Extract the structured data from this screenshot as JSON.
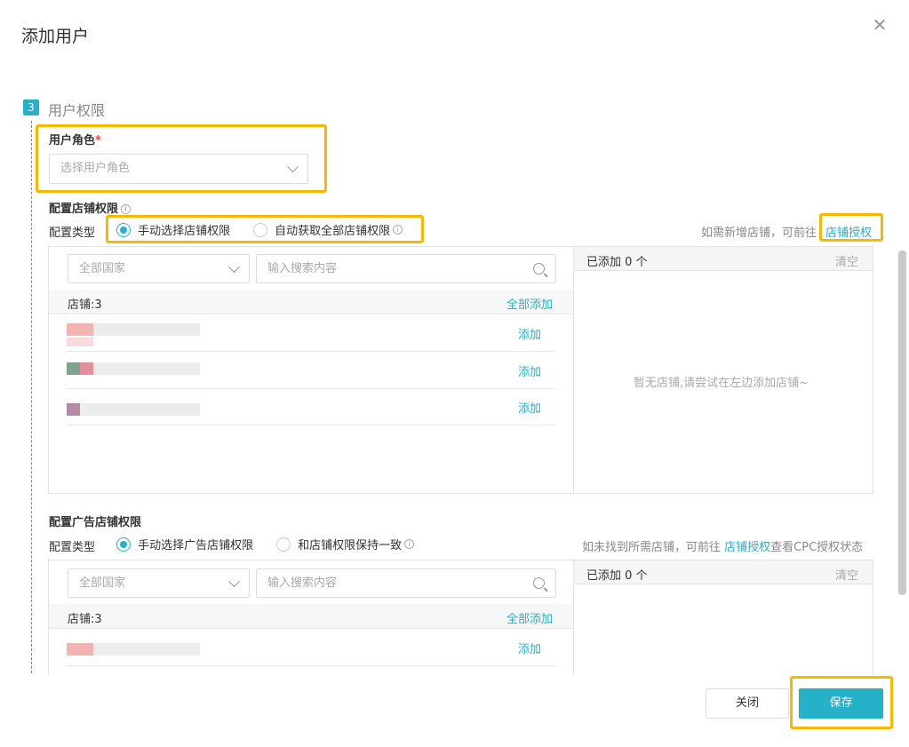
{
  "dialog": {
    "title": "添加用户",
    "close_icon": "close-icon"
  },
  "step": {
    "number": "3",
    "title": "用户权限"
  },
  "role": {
    "label": "用户角色",
    "required_mark": "*",
    "placeholder": "选择用户角色"
  },
  "store_perm": {
    "label": "配置店铺权限",
    "type_label": "配置类型",
    "option_manual": "手动选择店铺权限",
    "option_auto": "自动获取全部店铺权限",
    "hint_prefix": "如需新增店铺，可前往",
    "hint_link": "店铺授权",
    "country_placeholder": "全部国家",
    "search_placeholder": "输入搜索内容",
    "store_count": "店铺:3",
    "add_all": "全部添加",
    "rows": [
      {
        "add": "添加",
        "colors": [
          "#f2b3b3",
          "#e9e9e9"
        ]
      },
      {
        "add": "添加",
        "colors": [
          "#7fa38c",
          "#e58f9c"
        ]
      },
      {
        "add": "添加",
        "colors": [
          "#b98aa3",
          "#e9e9e9"
        ]
      }
    ],
    "added_label": "已添加 0 个",
    "clear": "清空",
    "empty_text": "暂无店铺,请尝试在左边添加店铺~"
  },
  "ad_perm": {
    "label": "配置广告店铺权限",
    "type_label": "配置类型",
    "option_manual": "手动选择广告店铺权限",
    "option_same": "和店铺权限保持一致",
    "hint_prefix": "如未找到所需店铺，可前往 ",
    "hint_link": "店铺授权",
    "hint_suffix": "查看CPC授权状态",
    "country_placeholder": "全部国家",
    "search_placeholder": "输入搜索内容",
    "store_count": "店铺:3",
    "add_all": "全部添加",
    "rows": [
      {
        "add": "添加",
        "colors": [
          "#f2b3b3",
          "#e9e9e9"
        ]
      }
    ],
    "added_label": "已添加 0 个",
    "clear": "清空"
  },
  "footer": {
    "close_label": "关闭",
    "save_label": "保存"
  },
  "colors": {
    "accent": "#25b1c8",
    "highlight": "#f7b800"
  }
}
